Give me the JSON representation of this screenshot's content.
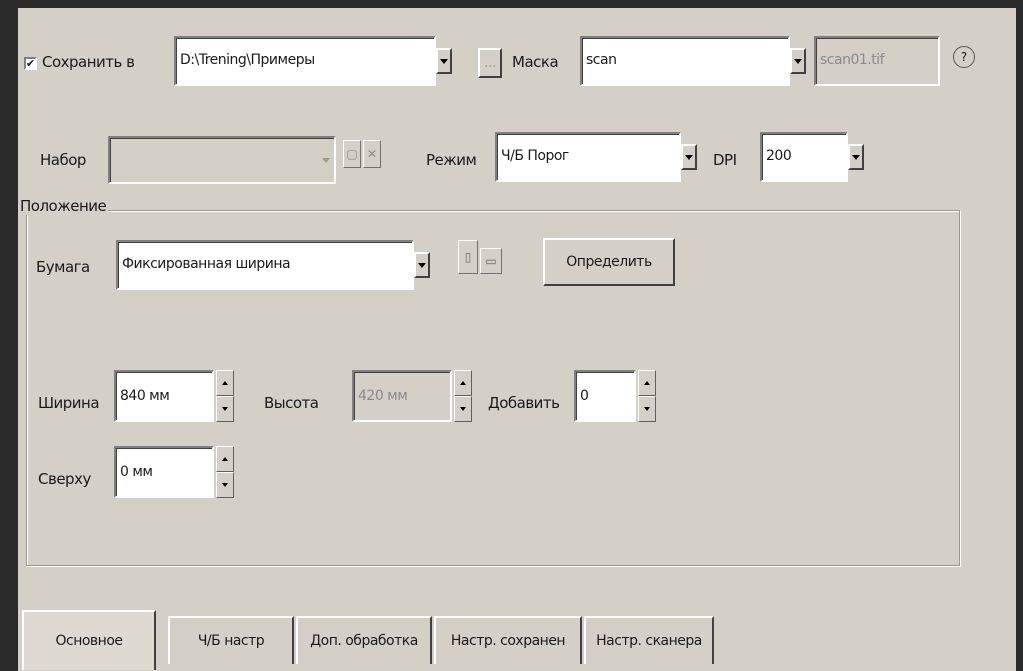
{
  "top": {
    "save_checked": true,
    "save_label": "Сохранить в",
    "save_path": "D:\\Trening\\Примеры",
    "browse_label": "...",
    "mask_label": "Маска",
    "mask_value": "scan",
    "filename_value": "scan01.tif",
    "help_glyph": "?"
  },
  "row2": {
    "set_label": "Набор",
    "set_value": "",
    "mode_label": "Режим",
    "mode_value": "Ч/Б Порог",
    "dpi_label": "DPI",
    "dpi_value": "200"
  },
  "position": {
    "group_label": "Положение",
    "paper_label": "Бумага",
    "paper_value": "Фиксированная ширина",
    "detect_label": "Определить",
    "width_label": "Ширина",
    "width_value": "840 мм",
    "height_label": "Высота",
    "height_value": "420 мм",
    "add_label": "Добавить",
    "add_value": "0",
    "top_label": "Сверху",
    "top_value": "0 мм"
  },
  "tabs": [
    {
      "label": "Основное",
      "active": true
    },
    {
      "label": "Ч/Б настр",
      "active": false
    },
    {
      "label": "Доп. обработка",
      "active": false
    },
    {
      "label": "Настр. сохранен",
      "active": false
    },
    {
      "label": "Настр. сканера",
      "active": false
    }
  ]
}
